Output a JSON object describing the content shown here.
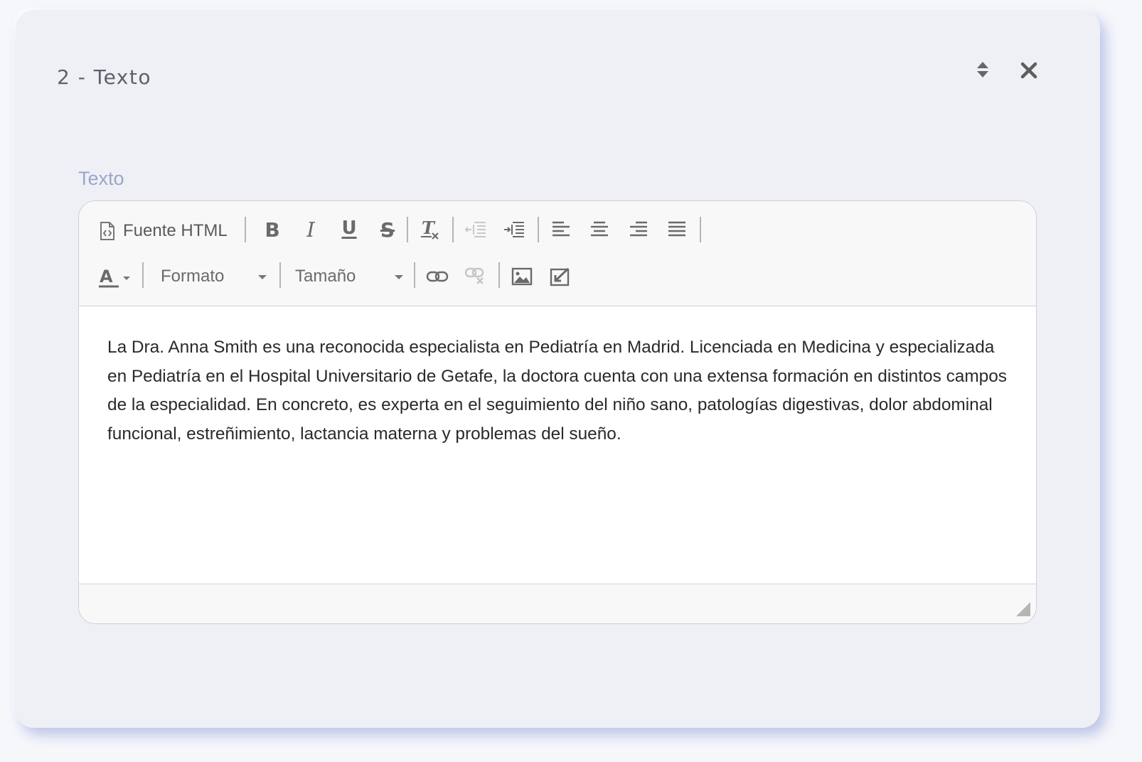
{
  "card": {
    "title": "2 - Texto",
    "icons": [
      "sort-icon",
      "close-icon"
    ]
  },
  "field": {
    "label": "Texto"
  },
  "toolbar": {
    "source_label": "Fuente HTML",
    "bold": "B",
    "italic": "I",
    "underline": "U",
    "strike": "S",
    "format_placeholder": "Formato",
    "size_placeholder": "Tamaño",
    "icons": [
      "source-icon",
      "remove-format-icon",
      "outdent-icon",
      "indent-icon",
      "align-left-icon",
      "align-center-icon",
      "align-right-icon",
      "align-justify-icon",
      "text-color-icon",
      "link-icon",
      "unlink-icon",
      "image-icon",
      "iframe-icon"
    ]
  },
  "editor": {
    "content": "La Dra. Anna Smith es una reconocida especialista en Pediatría en Madrid. Licenciada en Medicina y especializada en Pediatría en el Hospital Universitario de Getafe, la doctora cuenta con una extensa formación en distintos campos de la especialidad. En concreto, es experta en el seguimiento del niño sano, patologías digestivas, dolor abdominal funcional, estreñimiento, lactancia materna y problemas del sueño."
  }
}
